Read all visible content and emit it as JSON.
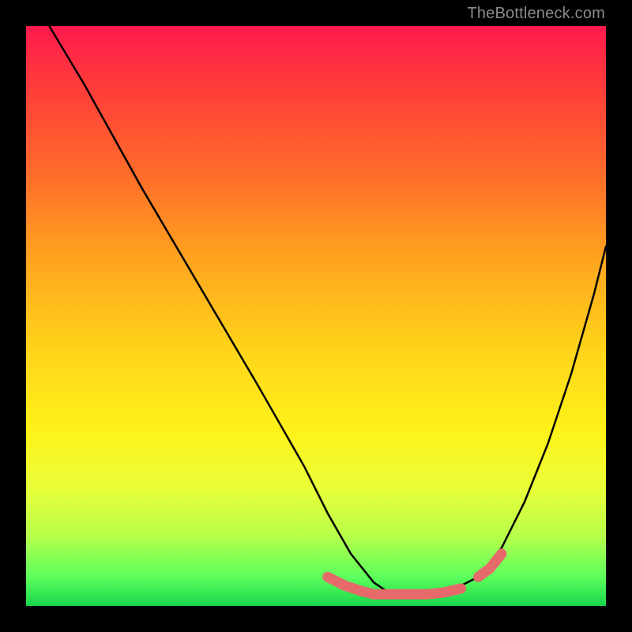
{
  "watermark": "TheBottleneck.com",
  "chart_data": {
    "type": "line",
    "title": "",
    "xlabel": "",
    "ylabel": "",
    "xlim": [
      0,
      100
    ],
    "ylim": [
      0,
      100
    ],
    "series": [
      {
        "name": "curve",
        "x": [
          4,
          10,
          20,
          30,
          40,
          48,
          52,
          56,
          60,
          63,
          66,
          70,
          74,
          78,
          82,
          86,
          90,
          94,
          98,
          100
        ],
        "values": [
          100,
          90,
          72,
          55,
          38,
          24,
          16,
          9,
          4,
          2,
          2,
          2,
          3,
          5,
          10,
          18,
          28,
          40,
          54,
          62
        ]
      },
      {
        "name": "highlight-segment-left",
        "x": [
          52,
          55,
          58,
          60
        ],
        "values": [
          5,
          3.5,
          2.5,
          2
        ]
      },
      {
        "name": "highlight-segment-bottom",
        "x": [
          60,
          63,
          66,
          69,
          72,
          75
        ],
        "values": [
          2,
          2,
          2,
          2,
          2.3,
          3
        ]
      },
      {
        "name": "highlight-segment-right",
        "x": [
          78,
          80,
          82
        ],
        "values": [
          5,
          6.5,
          9
        ]
      }
    ],
    "colors": {
      "gradient_top": "#ff1a4d",
      "gradient_bottom": "#18d64c",
      "curve_stroke": "#000000",
      "highlight_stroke": "#e66a6a"
    }
  }
}
